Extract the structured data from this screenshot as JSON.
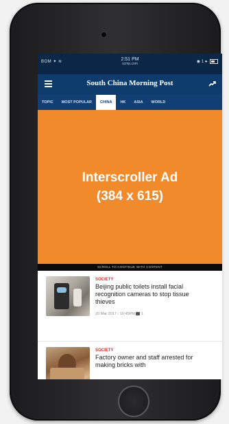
{
  "status": {
    "left": "BOM ✦ ≋",
    "time": "2:51 PM",
    "url": "scmp.com",
    "right": "◉ 1 ●"
  },
  "header": {
    "brand": "South China Morning Post"
  },
  "tabs": [
    {
      "label": "TOPIC"
    },
    {
      "label": "MOST POPULAR"
    },
    {
      "label": "CHINA"
    },
    {
      "label": "HK"
    },
    {
      "label": "ASIA"
    },
    {
      "label": "WORLD"
    }
  ],
  "ad": {
    "line1": "Interscroller Ad",
    "line2": "(384 x 615)",
    "footer": "SCROLL TO CONTINUE WITH CONTENT"
  },
  "articles": [
    {
      "category": "SOCIETY",
      "headline": "Beijing public toilets install facial recognition cameras to stop tissue thieves",
      "meta": "20 Mar 2017 - 10:45PM",
      "comments": "1"
    },
    {
      "category": "SOCIETY",
      "headline": "Factory owner and staff arrested for making bricks with",
      "meta": "",
      "comments": ""
    }
  ],
  "colors": {
    "nav": "#0d3b6c",
    "ad": "#f18a2b",
    "category": "#e1322d"
  }
}
